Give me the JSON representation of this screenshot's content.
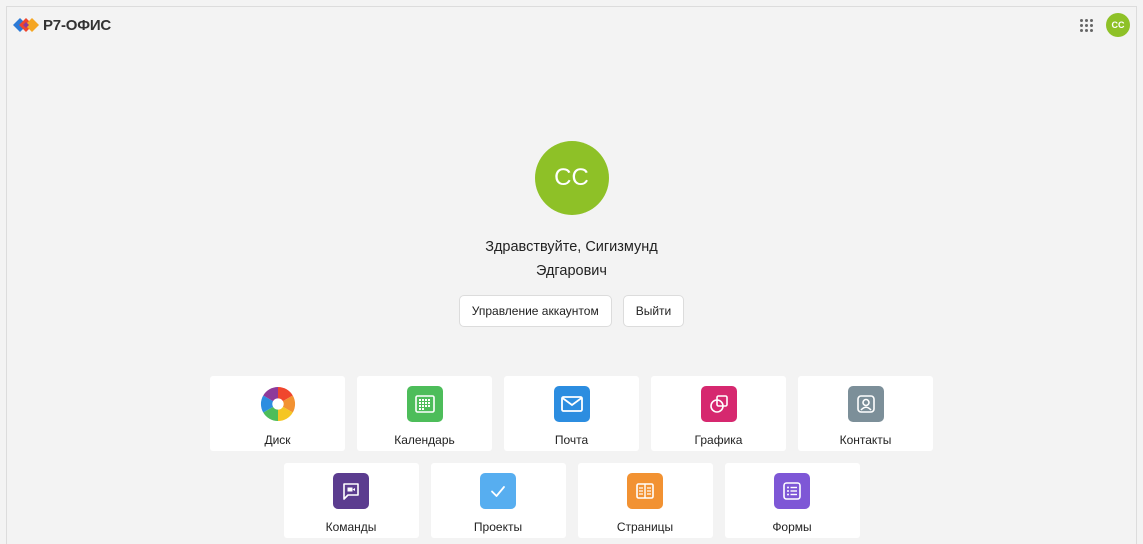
{
  "header": {
    "logo_text": "Р7-ОФИС",
    "avatar_initials": "CC"
  },
  "profile": {
    "avatar_initials": "CC",
    "greeting_line1": "Здравствуйте, Сигизмунд",
    "greeting_line2": "Эдгарович",
    "manage_label": "Управление аккаунтом",
    "logout_label": "Выйти"
  },
  "apps": {
    "row1": [
      {
        "label": "Диск",
        "icon": "disk-icon",
        "color": "multicolor"
      },
      {
        "label": "Календарь",
        "icon": "calendar-icon",
        "color": "#4dbd5a"
      },
      {
        "label": "Почта",
        "icon": "mail-icon",
        "color": "#2c8de0"
      },
      {
        "label": "Графика",
        "icon": "graphics-icon",
        "color": "#d6286f"
      },
      {
        "label": "Контакты",
        "icon": "contacts-icon",
        "color": "#7c8f99"
      }
    ],
    "row2": [
      {
        "label": "Команды",
        "icon": "teams-icon",
        "color": "#5b3c8f"
      },
      {
        "label": "Проекты",
        "icon": "projects-icon",
        "color": "#57aef0"
      },
      {
        "label": "Страницы",
        "icon": "pages-icon",
        "color": "#f29232"
      },
      {
        "label": "Формы",
        "icon": "forms-icon",
        "color": "#7e57d6"
      }
    ]
  }
}
